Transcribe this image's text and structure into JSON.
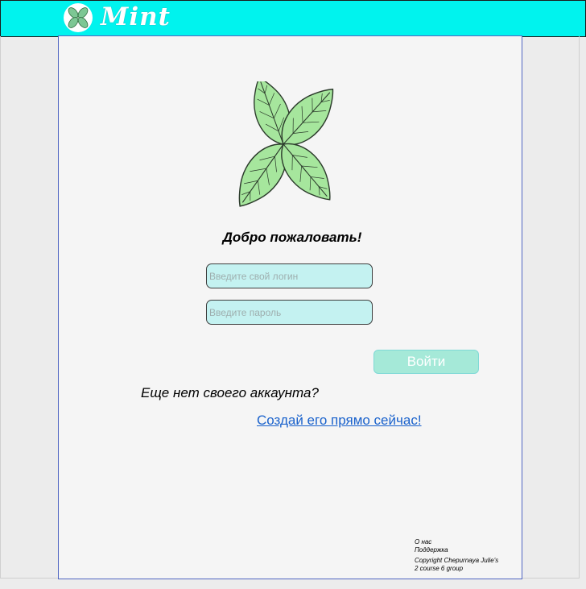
{
  "header": {
    "brand": "Mint",
    "logo_icon": "mint-leaf-icon",
    "accent_color": "#00f3ee"
  },
  "hero": {
    "icon": "mint-leaves-icon"
  },
  "main": {
    "welcome": "Добро пожаловать!",
    "login_placeholder": "Введите свой логин",
    "password_placeholder": "Введите пароль",
    "submit_label": "Войти",
    "no_account_text": "Еще нет своего аккаунта?",
    "signup_link": "Создай его прямо сейчас!"
  },
  "footer": {
    "about": "О нас",
    "support": "Поддержка",
    "copyright": "Copyright Chepurnaya Julie's",
    "course": "2 course  6 group"
  }
}
